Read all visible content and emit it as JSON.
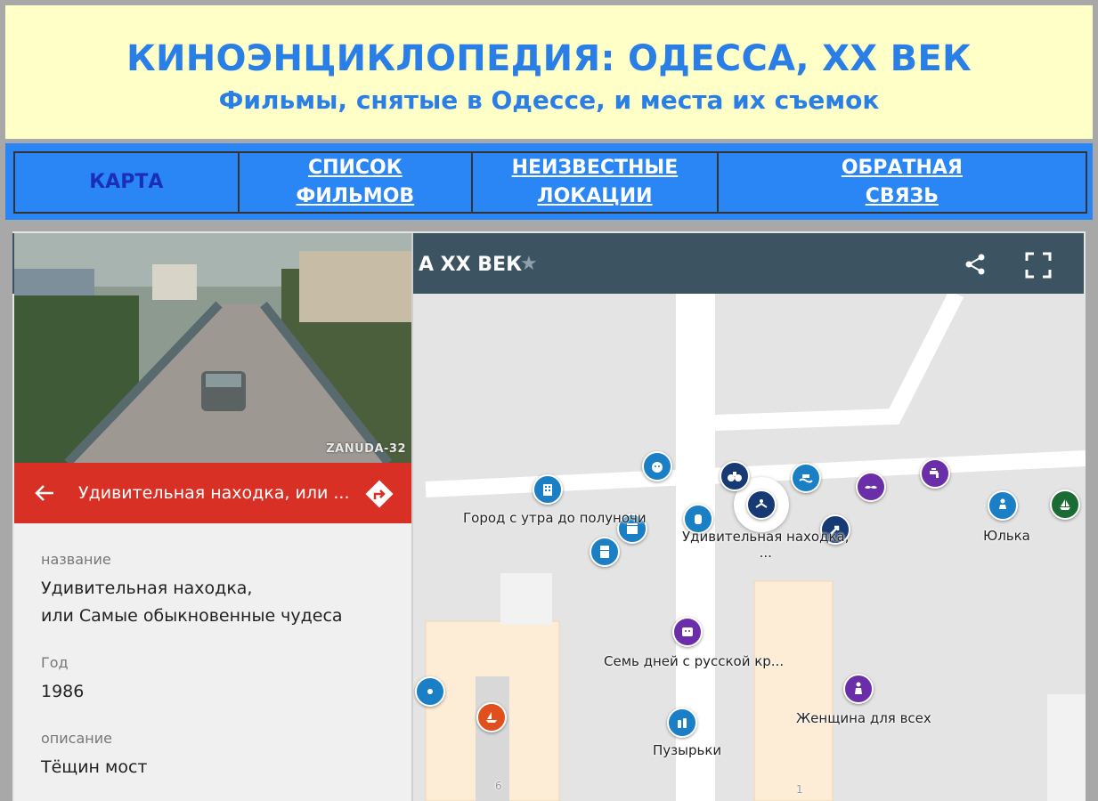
{
  "header": {
    "title": "КИНОЭНЦИКЛОПЕДИЯ: ОДЕССА, ХХ ВЕК",
    "subtitle": "Фильмы, снятые в Одессе, и места их съемок"
  },
  "nav": {
    "items": [
      {
        "label_line1": "КАРТА",
        "label_line2": "",
        "active": true
      },
      {
        "label_line1": "СПИСОК",
        "label_line2": "ФИЛЬМОВ",
        "active": false
      },
      {
        "label_line1": "НЕИЗВЕСТНЫЕ",
        "label_line2": "ЛОКАЦИИ",
        "active": false
      },
      {
        "label_line1": "ОБРАТНАЯ",
        "label_line2": "СВЯЗЬ",
        "active": false
      }
    ]
  },
  "map": {
    "title_partial": "А ХХ ВЕК",
    "labels": {
      "city": "Город с утра до полуночи",
      "find_line1": "Удивительная находка,",
      "find_line2": "...",
      "yulka": "Юлька",
      "seven_days": "Семь дней с русской кр...",
      "woman": "Женщина для всех",
      "bubbles": "Пузырьки",
      "num6": "6",
      "num1": "1"
    }
  },
  "panel": {
    "photo_watermark": "ZANUDA-32",
    "title": "Удивительная находка, или ...",
    "fields": {
      "name_label": "название",
      "name_line1": "Удивительная находка,",
      "name_line2": "или Самые обыкновенные чудеса",
      "year_label": "Год",
      "year_value": "1986",
      "desc_label": "описание",
      "desc_value": "Тёщин мост"
    }
  },
  "colors": {
    "header_bg": "#ffffc8",
    "header_text": "#2a7fe6",
    "nav_bg": "#2a85f5",
    "nav_active": "#1a2fb8",
    "toolbar_bg": "#3c5461",
    "panel_bar": "#d93025"
  },
  "icons": [
    "star-icon",
    "share-icon",
    "fullscreen-icon",
    "back-arrow-icon",
    "directions-icon"
  ]
}
